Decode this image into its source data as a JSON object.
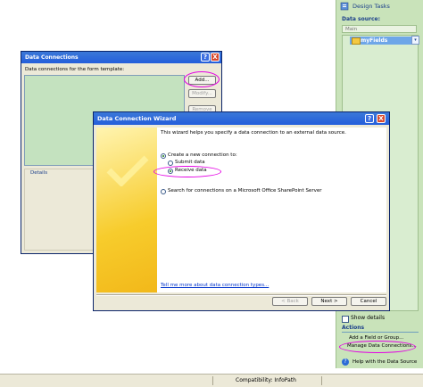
{
  "taskpane": {
    "title": "Design Tasks",
    "data_source_label": "Data source:",
    "data_source_value": "Main",
    "tree_item": "myFields",
    "show_details": "Show details",
    "actions_label": "Actions",
    "add_field": "Add a Field or Group...",
    "manage_data_connections": "Manage Data Connections...",
    "help": "Help with the Data Source"
  },
  "statusbar": {
    "text": "Compatibility: InfoPath"
  },
  "data_connections": {
    "title": "Data Connections",
    "help_glyph": "?",
    "close_glyph": "X",
    "list_label": "Data connections for the form template:",
    "add": "Add...",
    "modify": "Modify...",
    "remove": "Remove",
    "details": "Details"
  },
  "wizard": {
    "title": "Data Connection Wizard",
    "help_glyph": "?",
    "close_glyph": "X",
    "intro": "This wizard helps you specify a data connection to an external data source.",
    "create_new": "Create a new connection to:",
    "submit": "Submit data",
    "receive": "Receive data",
    "sharepoint": "Search for connections on a Microsoft Office SharePoint Server",
    "tell_me": "Tell me more about data connection types...",
    "back": "< Back",
    "next": "Next >",
    "cancel": "Cancel"
  },
  "colors": {
    "annotation": "#e400e4",
    "titlebar": "#245edb",
    "taskpane": "#c9e3ba"
  }
}
